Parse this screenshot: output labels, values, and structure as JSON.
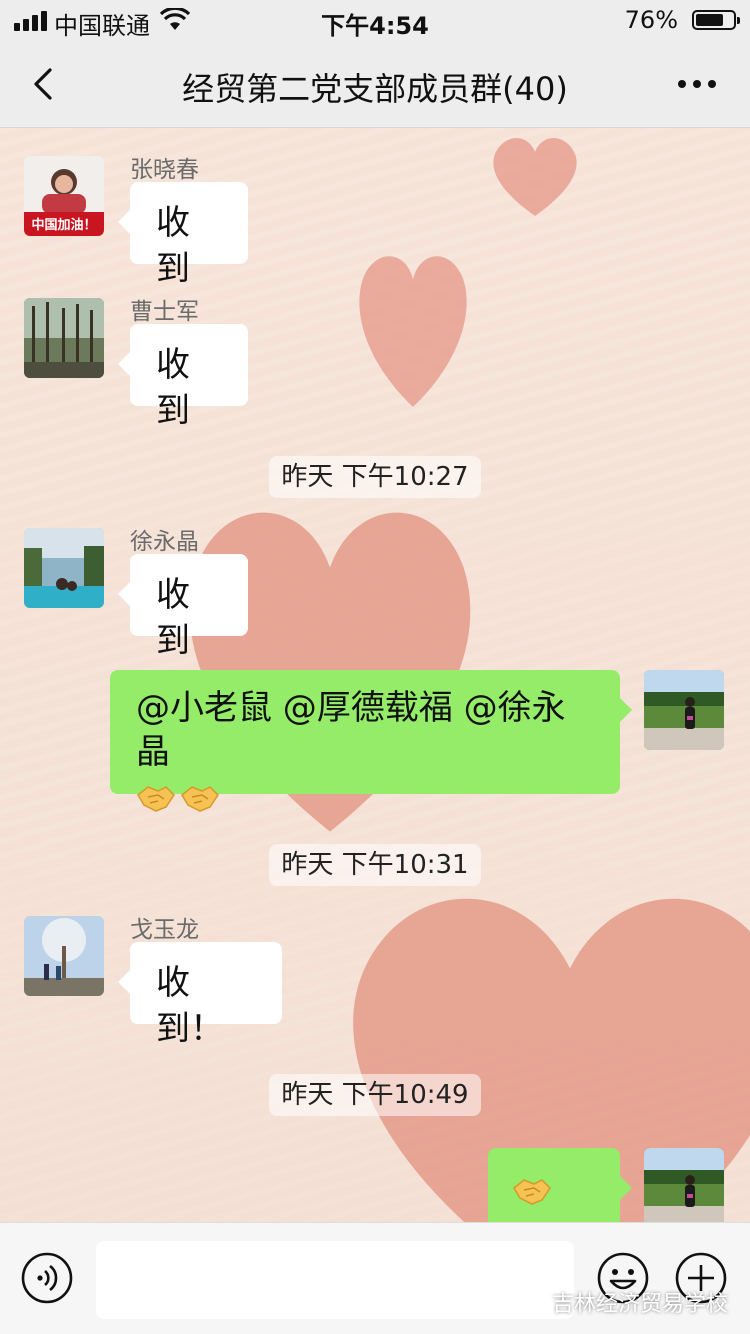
{
  "status_bar": {
    "carrier": "中国联通",
    "time": "下午4:54",
    "battery_percent": "76%",
    "battery_level": 0.76
  },
  "nav": {
    "title": "经贸第二党支部成员群(40)"
  },
  "messages": [
    {
      "sender": "张晓春",
      "text": "收到",
      "avatar_badge": "中国加油！"
    },
    {
      "sender": "曹士军",
      "text": "收到"
    },
    {
      "timestamp": "昨天 下午10:27"
    },
    {
      "sender": "徐永晶",
      "text": "收到"
    },
    {
      "mine": true,
      "text": "@小老鼠 @厚德载福 @徐永晶",
      "emoji": [
        "handshake-emoji",
        "handshake-emoji"
      ]
    },
    {
      "timestamp": "昨天 下午10:31"
    },
    {
      "sender": "戈玉龙",
      "text": "收到！"
    },
    {
      "timestamp": "昨天 下午10:49"
    },
    {
      "mine": true,
      "emoji": [
        "handshake-emoji",
        "handshake-emoji"
      ]
    }
  ],
  "watermark": "吉林经济贸易学校",
  "colors": {
    "my_bubble": "#95ec69",
    "other_bubble": "#ffffff",
    "bar_bg": "#ededed",
    "heart": "#e49a88"
  }
}
